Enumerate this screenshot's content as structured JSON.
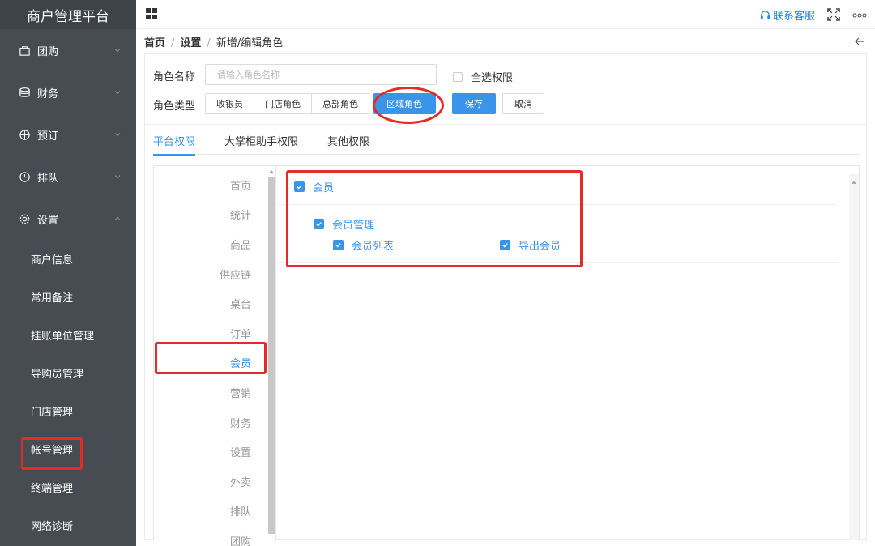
{
  "sidebar": {
    "brand": "商户管理平台",
    "groups": [
      {
        "label": "团购",
        "icon": "bag-icon"
      },
      {
        "label": "财务",
        "icon": "database-icon"
      },
      {
        "label": "预订",
        "icon": "compass-icon"
      },
      {
        "label": "排队",
        "icon": "clock-icon"
      },
      {
        "label": "设置",
        "icon": "gear-icon"
      }
    ],
    "settings_items": [
      "商户信息",
      "常用备注",
      "挂账单位管理",
      "导购员管理",
      "门店管理",
      "帐号管理",
      "终端管理",
      "网络诊断"
    ]
  },
  "topbar": {
    "support_label": "联系客服"
  },
  "breadcrumb": {
    "home": "首页",
    "settings": "设置",
    "current": "新增/编辑角色"
  },
  "form": {
    "name_label": "角色名称",
    "name_placeholder": "请输入角色名称",
    "select_all_label": "全选权限",
    "type_label": "角色类型",
    "type_options": [
      "收银员",
      "门店角色",
      "总部角色",
      "区域角色"
    ],
    "save_label": "保存",
    "cancel_label": "取消"
  },
  "tabs": [
    "平台权限",
    "大掌柜助手权限",
    "其他权限"
  ],
  "permission_menu": [
    "首页",
    "统计",
    "商品",
    "供应链",
    "桌台",
    "订单",
    "会员",
    "营销",
    "财务",
    "设置",
    "外卖",
    "排队",
    "团购"
  ],
  "permissions": {
    "module": "会员",
    "group": "会员管理",
    "items": [
      "会员列表",
      "导出会员"
    ]
  },
  "colors": {
    "sidebar_bg": "#474c53",
    "accent": "#3a94e8",
    "highlight": "#e52a2a"
  }
}
